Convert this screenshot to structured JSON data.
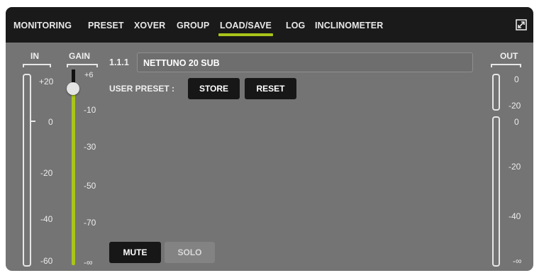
{
  "tabs": [
    {
      "label": "MONITORING",
      "active": false
    },
    {
      "label": "PRESET",
      "active": false
    },
    {
      "label": "XOVER",
      "active": false
    },
    {
      "label": "GROUP",
      "active": false
    },
    {
      "label": "LOAD/SAVE",
      "active": true
    },
    {
      "label": "LOG",
      "active": false
    },
    {
      "label": "INCLINOMETER",
      "active": false
    }
  ],
  "accent_color": "#a8c51a",
  "in_meter": {
    "header": "IN",
    "scale": [
      "+20",
      "0",
      "-20",
      "-40",
      "-60"
    ]
  },
  "gain": {
    "header": "GAIN",
    "scale": [
      "+6",
      "-10",
      "-30",
      "-50",
      "-70",
      "-∞"
    ],
    "value_db": 6
  },
  "out_meter": {
    "header": "OUT",
    "top_scale": [
      "0",
      "-20"
    ],
    "bottom_scale": [
      "0",
      "-20",
      "-40",
      "-∞"
    ]
  },
  "channel": {
    "id": "1.1.1",
    "name": "NETTUNO 20 SUB"
  },
  "user_preset": {
    "label": "USER PRESET :",
    "store_label": "STORE",
    "reset_label": "RESET"
  },
  "mute_label": "MUTE",
  "solo_label": "SOLO"
}
